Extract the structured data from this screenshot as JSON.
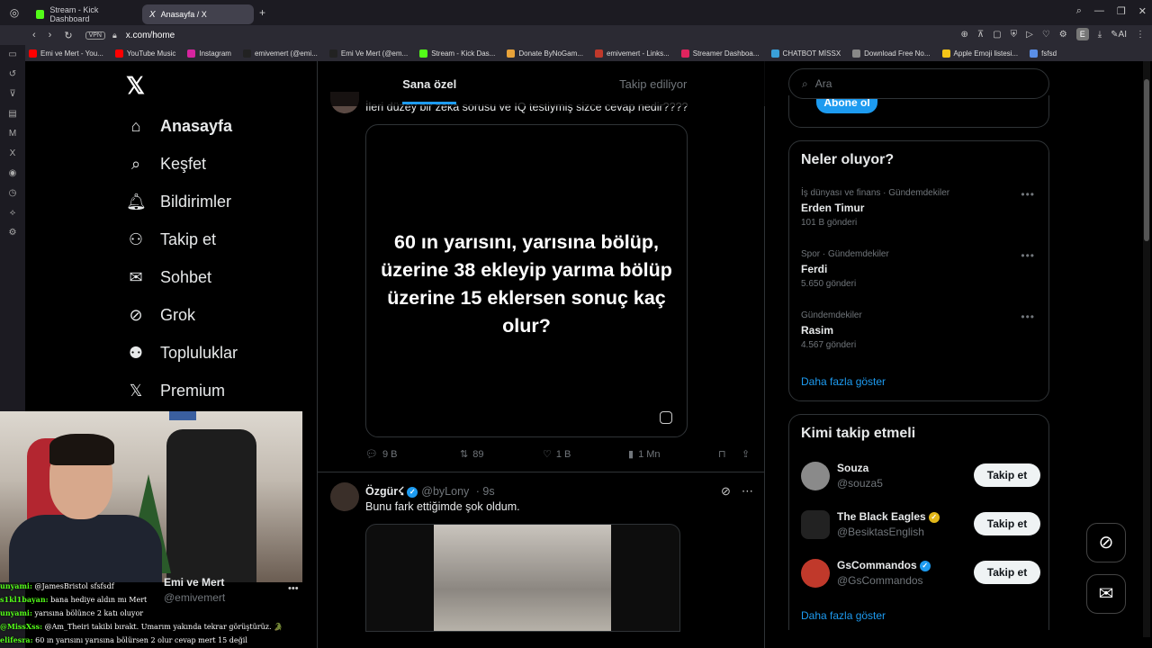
{
  "browser": {
    "tabs": [
      {
        "label": "Stream - Kick Dashboard",
        "active": false,
        "color": "#53fc18"
      },
      {
        "label": "Anasayfa / X",
        "active": true,
        "color": "#ffffff"
      }
    ],
    "vpn": "VPN",
    "url": "x.com/home",
    "bookmarks": [
      {
        "label": "Emi ve Mert - You...",
        "color": "#ff0000"
      },
      {
        "label": "YouTube Music",
        "color": "#ff0000"
      },
      {
        "label": "Instagram",
        "color": "#d6249f"
      },
      {
        "label": "emivemert (@emi...",
        "color": "#222222"
      },
      {
        "label": "Emi Ve Mert (@em...",
        "color": "#222222"
      },
      {
        "label": "Stream - Kick Das...",
        "color": "#53fc18"
      },
      {
        "label": "Donate ByNoGam...",
        "color": "#e8a33a"
      },
      {
        "label": "emivemert - Links...",
        "color": "#c0392b"
      },
      {
        "label": "Streamer Dashboa...",
        "color": "#e0245e"
      },
      {
        "label": "CHATBOT MİSSX",
        "color": "#3aa0d8"
      },
      {
        "label": "Download Free No...",
        "color": "#888888"
      },
      {
        "label": "Apple Emoji listesi...",
        "color": "#f5c518"
      },
      {
        "label": "fsfsd",
        "color": "#5a8ee6"
      }
    ],
    "ext_letter": "E"
  },
  "sidebar": {
    "items": [
      {
        "label": "Anasayfa",
        "icon": "home-icon",
        "glyph": "⌂"
      },
      {
        "label": "Keşfet",
        "icon": "search-icon",
        "glyph": "⌕"
      },
      {
        "label": "Bildirimler",
        "icon": "bell-icon",
        "glyph": "♫"
      },
      {
        "label": "Takip et",
        "icon": "add-user-icon",
        "glyph": "⚇"
      },
      {
        "label": "Sohbet",
        "icon": "mail-icon",
        "glyph": "✉"
      },
      {
        "label": "Grok",
        "icon": "grok-icon",
        "glyph": "⊘"
      },
      {
        "label": "Topluluklar",
        "icon": "communities-icon",
        "glyph": "⚉"
      },
      {
        "label": "Premium",
        "icon": "x-premium-icon",
        "glyph": "X"
      }
    ]
  },
  "feed": {
    "tabs": [
      "Sana özel",
      "Takip ediliyor"
    ],
    "post1": {
      "text": "İleri düzey bir zeka sorusu ve IQ testiymiş sizce cevap nedir????",
      "image_text": "60 ın yarısını, yarısına bölüp, üzerine 38 ekleyip yarıma bölüp üzerine 15 eklersen sonuç kaç olur?",
      "replies": "9 B",
      "reposts": "89",
      "likes": "1 B",
      "views": "1 Mn"
    },
    "post2": {
      "name": "Özgür☇",
      "handle": "@byLony",
      "time": "· 9s",
      "text": "Bunu fark ettiğimde şok oldum."
    }
  },
  "right": {
    "search_placeholder": "Ara",
    "subscribe_label": "Abone ol",
    "trends_title": "Neler oluyor?",
    "trends": [
      {
        "category": "İş dünyası ve finans · Gündemdekiler",
        "name": "Erden Timur",
        "count": "101 B gönderi"
      },
      {
        "category": "Spor · Gündemdekiler",
        "name": "Ferdi",
        "count": "5.650 gönderi"
      },
      {
        "category": "Gündemdekiler",
        "name": "Rasim",
        "count": "4.567 gönderi"
      }
    ],
    "show_more": "Daha fazla göster",
    "who_title": "Kimi takip etmeli",
    "who": [
      {
        "name": "Souza",
        "handle": "@souza5",
        "color": "#8a8a8a"
      },
      {
        "name": "The Black Eagles",
        "handle": "@BesiktasEnglish",
        "color": "#222222"
      },
      {
        "name": "GsCommandos",
        "handle": "@GsCommandos",
        "color": "#c0392b"
      }
    ],
    "follow_label": "Takip et"
  },
  "stream_overlay": {
    "profile_name": "Emi ve Mert",
    "profile_handle": "@emivemert",
    "chat": [
      {
        "user": "unyami:",
        "msg": "@JamesBristol sfsfsdf"
      },
      {
        "user": "s1kl1bayan:",
        "msg": "bana hediye aldın mı Mert"
      },
      {
        "user": "unyami:",
        "msg": "yarısına bölünce 2 katı oluyor"
      },
      {
        "user": "@MissXss:",
        "msg": "@Am_Theiri takibi bırakt. Umarım yakında tekrar görüştürüz. 🐊"
      },
      {
        "user": "elifesra:",
        "msg": "60 ın yarısını yarısına bölürsen 2 olur cevap mert 15 değil"
      }
    ]
  }
}
